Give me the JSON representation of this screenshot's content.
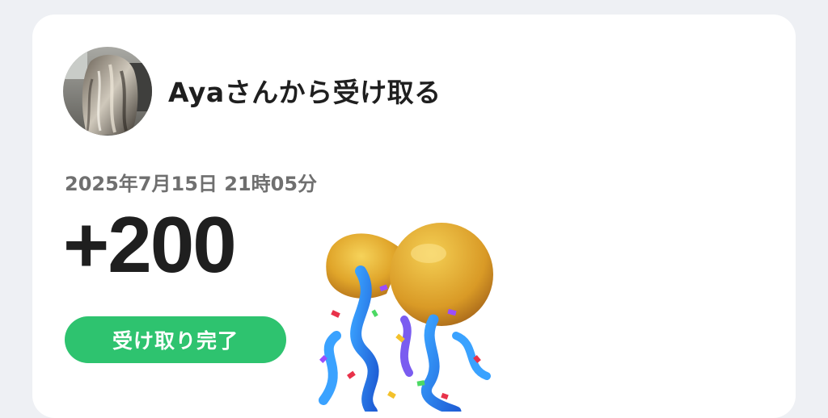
{
  "receipt": {
    "sender_title": "Ayaさんから受け取る",
    "date": "2025年7月15日 21時05分",
    "amount": "+200",
    "status": "受け取り完了",
    "icons": {
      "avatar": "user-avatar-photo",
      "celebration": "party-popper-icon"
    },
    "colors": {
      "status_badge": "#2ec36f",
      "page_background": "#eef0f4",
      "card_background": "#ffffff"
    }
  }
}
